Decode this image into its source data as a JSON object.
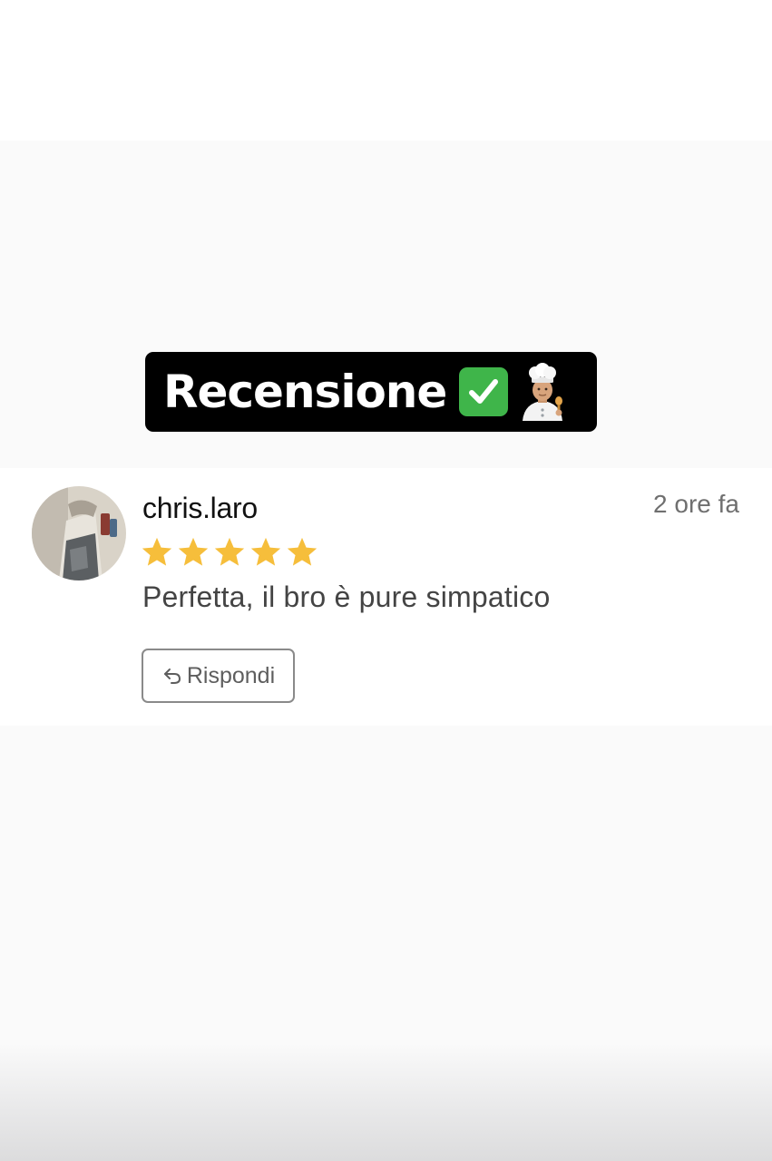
{
  "header": {
    "title": "Recensione",
    "check_icon": "white-check-mark-icon",
    "chef_icon": "chef-emoji-icon"
  },
  "review": {
    "author": "chris.laro",
    "time": "2 ore fa",
    "rating": 5,
    "max_rating": 5,
    "text": "Perfetta, il bro è pure simpatico",
    "reply_label": "Rispondi",
    "reply_icon": "reply-arrow-icon"
  },
  "colors": {
    "star": "#f6be3b",
    "badge_bg": "#000000",
    "check_bg": "#3fb54a"
  }
}
